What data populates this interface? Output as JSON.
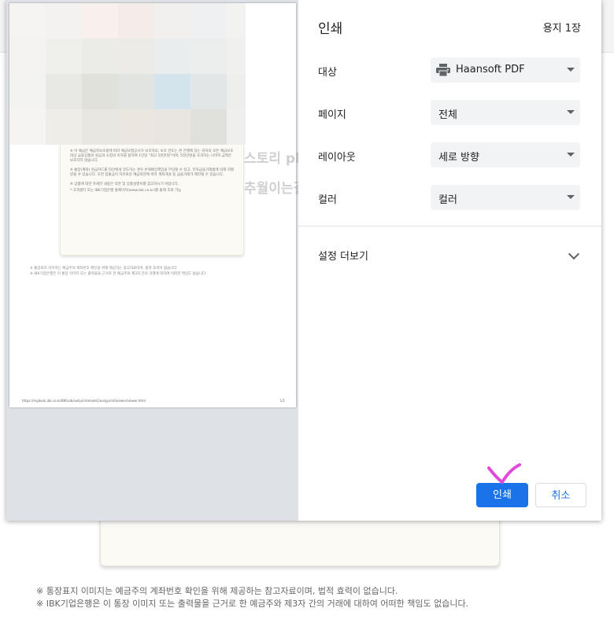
{
  "background": {
    "notes": [
      "※ 통장표지 이미지는 예금주의 계좌번호 확인을 위해 제공하는 참고자료이며, 법적 효력이 없습니다.",
      "※ IBK기업은행은 이 통장 이미지 또는 출력물을 근거로 한 예금주와 제3자 간의 거래에 대하여 어떠한 책임도 없습니다."
    ]
  },
  "preview": {
    "card_lines": [
      "※ 이 예금은 예금자보호법에 따라 예금보험공사가 보호하되, 보호 한도는 본 은행에 있는 귀하의 모든 예금보호 대상 금융상품의 원금과 소정의 이자를 합하여 1인당 \"최고 5천만원\"이며, 5천만원을 초과하는 나머지 금액은 보호하지 않습니다.",
      "※ 통장(계좌) 현금카드를 타인에게 양도하는 경우 손해배상책임을 부담할 수 있고, 전자금융거래법에 의해 처벌 받을 수 있습니다. 또한 입출금이 자유로운 예금약관에 따라 계좌개설 등 금융거래가 제한될 수 있습니다.",
      "※ 상품에 대한 자세한 내용은 약관 및 상품설명서를 참고하시기 바랍니다.",
      "* 고객센터 또는 IBK기업은행 홈페이지(www.ibk.co.kr)를 통해 조회 가능"
    ],
    "page_notes": [
      "※ 통장표지 이미지는 예금주의 계좌번호 확인을 위해 제공하는 참고자료이며, 법적 효력이 없습니다.",
      "※ IBK기업은행은 이 통장 이미지 또는 출력물을 근거로 한 예금주와 제3자 간의 거래에 대하여 어떠한 책임도 없습니다."
    ],
    "footer_url": "https://mybank.ibk.co.kr/IBK/uib/sw/ip/intimode2/easyprint/viewer/viewer.html",
    "footer_page": "1/1",
    "watermark_line1": "스토리 phot",
    "watermark_line2": "추월이는길~♡"
  },
  "settings": {
    "title": "인쇄",
    "sheet_count": "용지 1장",
    "destination": {
      "label": "대상",
      "value": "Haansoft PDF",
      "icon": "printer-icon"
    },
    "pages": {
      "label": "페이지",
      "value": "전체"
    },
    "layout": {
      "label": "레이아웃",
      "value": "세로 방향"
    },
    "color": {
      "label": "컬러",
      "value": "컬러"
    },
    "more_settings": "설정 더보기",
    "print_button": "인쇄",
    "cancel_button": "취소"
  },
  "colors": {
    "accent": "#1a73e8",
    "select_bg": "#f1f3f4",
    "preview_bg": "#dee1e6",
    "annotation": "#e04ad9"
  }
}
